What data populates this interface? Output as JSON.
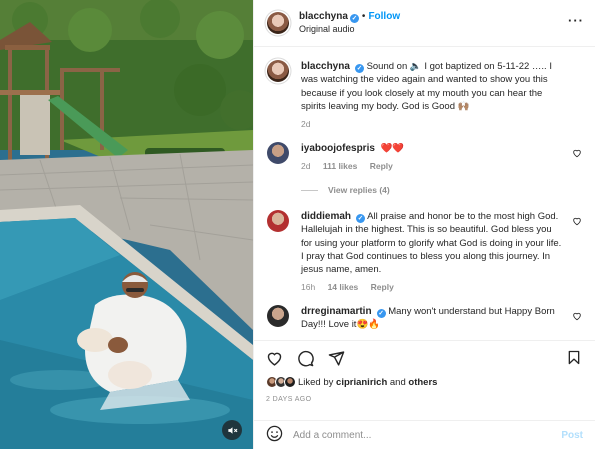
{
  "media": {
    "mute_icon": "speaker-muted-icon"
  },
  "header": {
    "username": "blacchyna",
    "verified": true,
    "separator": "•",
    "follow_label": "Follow",
    "audio": "Original audio",
    "more_icon": "more-horizontal-icon",
    "more_glyph": "···"
  },
  "caption": {
    "username": "blacchyna",
    "text": "Sound on 🔈 I got baptized on 5-11-22 ….. I was watching the video again and wanted to show you this because if you look closely at my mouth you can hear the spirits leaving my body. God is Good 🙌🏽",
    "time": "2d"
  },
  "comments": [
    {
      "username": "iyaboojofespris",
      "verified": false,
      "text": "❤️❤️",
      "time": "2d",
      "likes": "111 likes",
      "reply_label": "Reply"
    },
    {
      "username": "diddiemah",
      "verified": true,
      "text": "All praise and honor be to the most high God. Hallelujah in the highest. This is so beautiful. God bless you for using your platform to glorify what God is doing in your life. I pray that God continues to bless you along this journey. In jesus name, amen.",
      "time": "16h",
      "likes": "14 likes",
      "reply_label": "Reply"
    },
    {
      "username": "drreginamartin",
      "verified": true,
      "text": "Many won't understand but Happy Born Day!!! Love it😍🔥",
      "time": "",
      "likes": "",
      "reply_label": ""
    }
  ],
  "view_replies": "View replies (4)",
  "actions": {
    "icons": [
      "heart-icon",
      "comment-icon",
      "share-icon",
      "bookmark-icon"
    ],
    "liked_by_prefix": "Liked by",
    "liked_by_user": "ciprianirich",
    "liked_by_and": "and",
    "liked_by_others": "others",
    "date": "2 DAYS AGO"
  },
  "add_comment": {
    "emoji_icon": "emoji-smile-icon",
    "placeholder": "Add a comment...",
    "post_label": "Post"
  },
  "colors": {
    "link": "#0095f6",
    "post_disabled": "#b2dffc",
    "verified": "#3897f0",
    "heart_red": "#ed4956",
    "muted_text": "#8e8e8e"
  }
}
